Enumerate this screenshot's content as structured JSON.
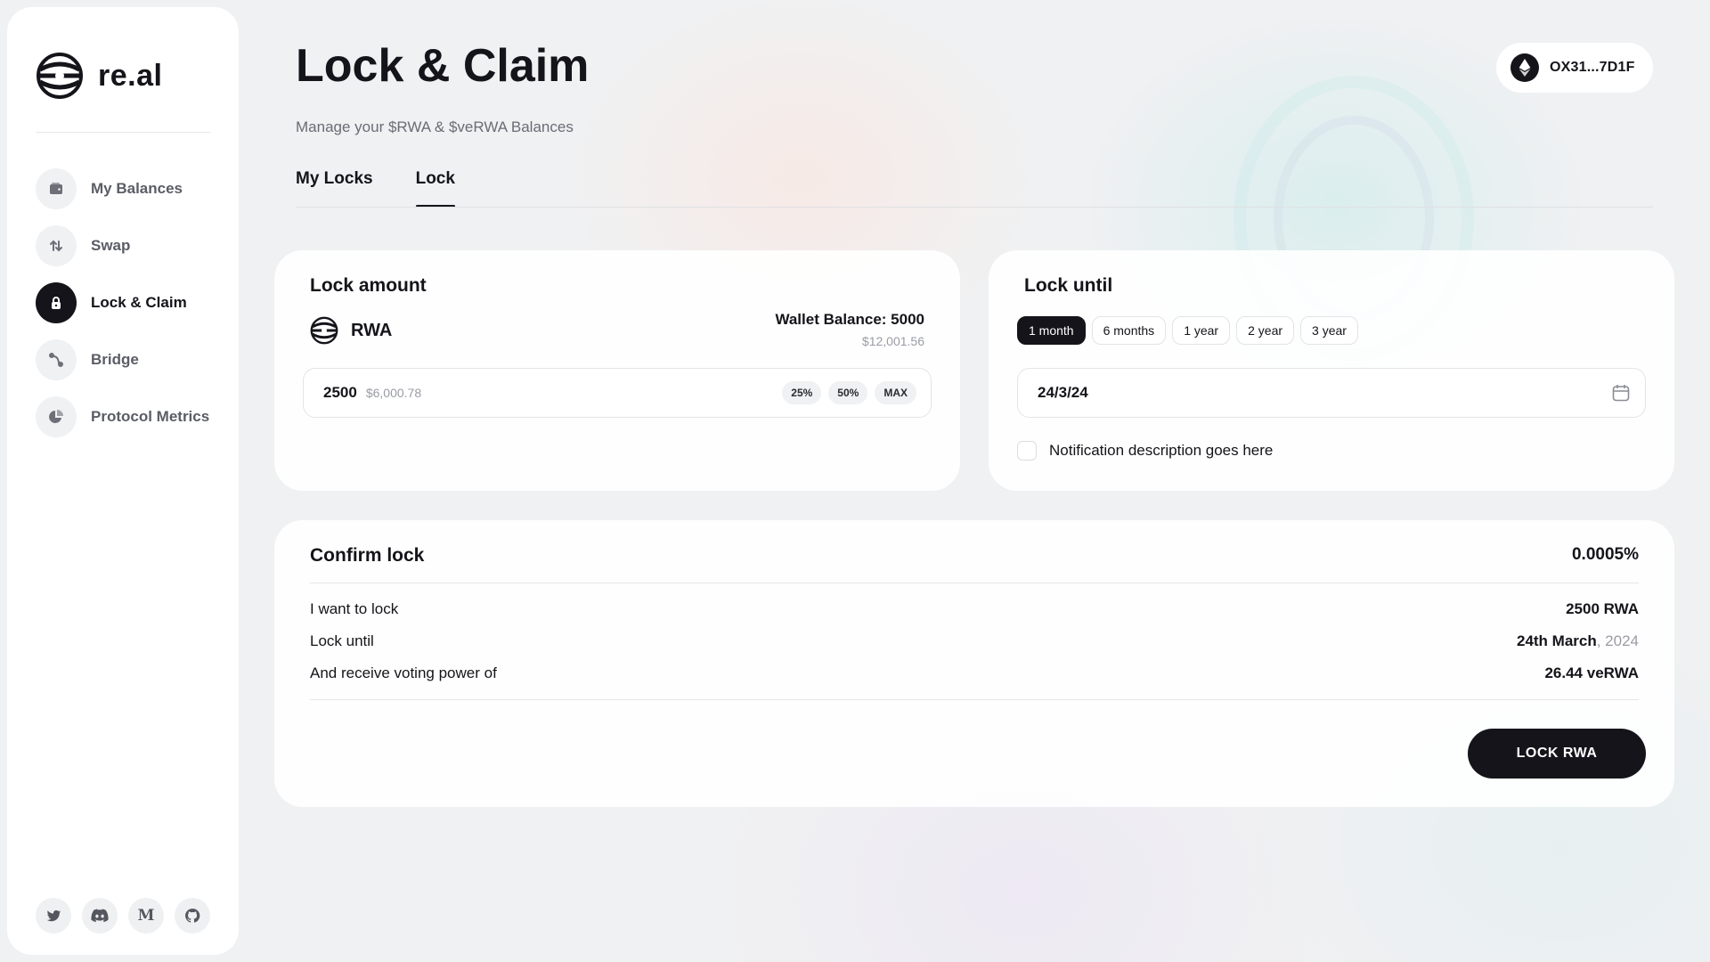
{
  "brand": {
    "name": "re.al"
  },
  "sidebar": {
    "items": [
      {
        "label": "My Balances",
        "icon": "wallet-icon",
        "active": false
      },
      {
        "label": "Swap",
        "icon": "swap-icon",
        "active": false
      },
      {
        "label": "Lock & Claim",
        "icon": "lock-icon",
        "active": true
      },
      {
        "label": "Bridge",
        "icon": "bridge-icon",
        "active": false
      },
      {
        "label": "Protocol Metrics",
        "icon": "pie-chart-icon",
        "active": false
      }
    ],
    "socials": [
      {
        "icon": "twitter-icon"
      },
      {
        "icon": "discord-icon"
      },
      {
        "icon": "medium-icon",
        "glyph": "M"
      },
      {
        "icon": "github-icon"
      }
    ]
  },
  "header": {
    "title": "Lock & Claim",
    "subtitle": "Manage your $RWA & $veRWA Balances",
    "wallet_address": "OX31...7D1F"
  },
  "tabs": [
    {
      "label": "My Locks",
      "active": false
    },
    {
      "label": "Lock",
      "active": true
    }
  ],
  "lock_amount": {
    "title": "Lock amount",
    "token": "RWA",
    "wallet_balance": "Wallet Balance: 5000",
    "wallet_balance_usd": "$12,001.56",
    "amount": "2500",
    "amount_usd": "$6,000.78",
    "percent_buttons": [
      "25%",
      "50%",
      "MAX"
    ]
  },
  "lock_until": {
    "title": "Lock until",
    "periods": [
      "1 month",
      "6 months",
      "1 year",
      "2 year",
      "3 year"
    ],
    "selected_period": "1 month",
    "date": "24/3/24",
    "notification_label": "Notification description goes here",
    "notification_checked": false
  },
  "confirm": {
    "title": "Confirm lock",
    "rate": "0.0005%",
    "rows": [
      {
        "label": "I want to lock",
        "value": "2500 RWA",
        "suffix": ""
      },
      {
        "label": "Lock until",
        "value": "24th March",
        "suffix": ", 2024"
      },
      {
        "label": "And receive voting power of",
        "value": "26.44 veRWA",
        "suffix": ""
      }
    ],
    "button_label": "LOCK RWA"
  },
  "colors": {
    "primary": "#14141a",
    "muted": "#9a9ca4",
    "card": "#ffffff"
  }
}
